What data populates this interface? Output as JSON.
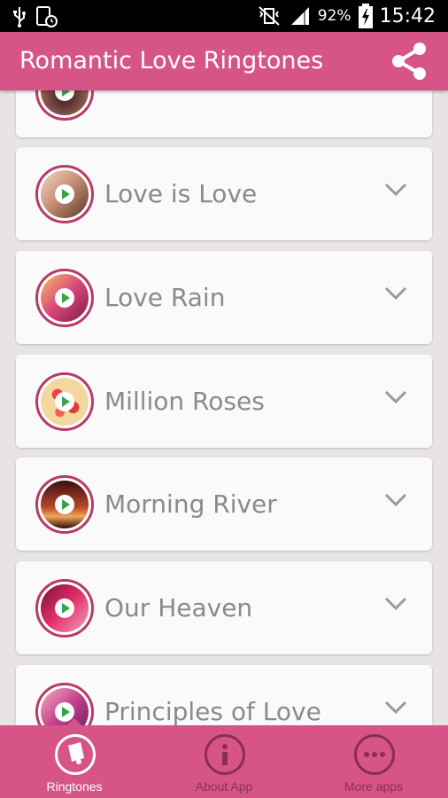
{
  "status_bar": {
    "battery": "92%",
    "time": "15:42"
  },
  "app_bar": {
    "title": "Romantic Love Ringtones"
  },
  "ringtones": [
    {
      "name": ""
    },
    {
      "name": "Love is Love"
    },
    {
      "name": "Love Rain"
    },
    {
      "name": "Million Roses"
    },
    {
      "name": "Morning River"
    },
    {
      "name": "Our Heaven"
    },
    {
      "name": "Principles of Love"
    }
  ],
  "bottom_nav": {
    "ringtones": "Ringtones",
    "about": "About App",
    "more": "More apps"
  },
  "colors": {
    "primary": "#d65586",
    "dark_pink": "#8b2e52",
    "play_green": "#3aa348"
  }
}
